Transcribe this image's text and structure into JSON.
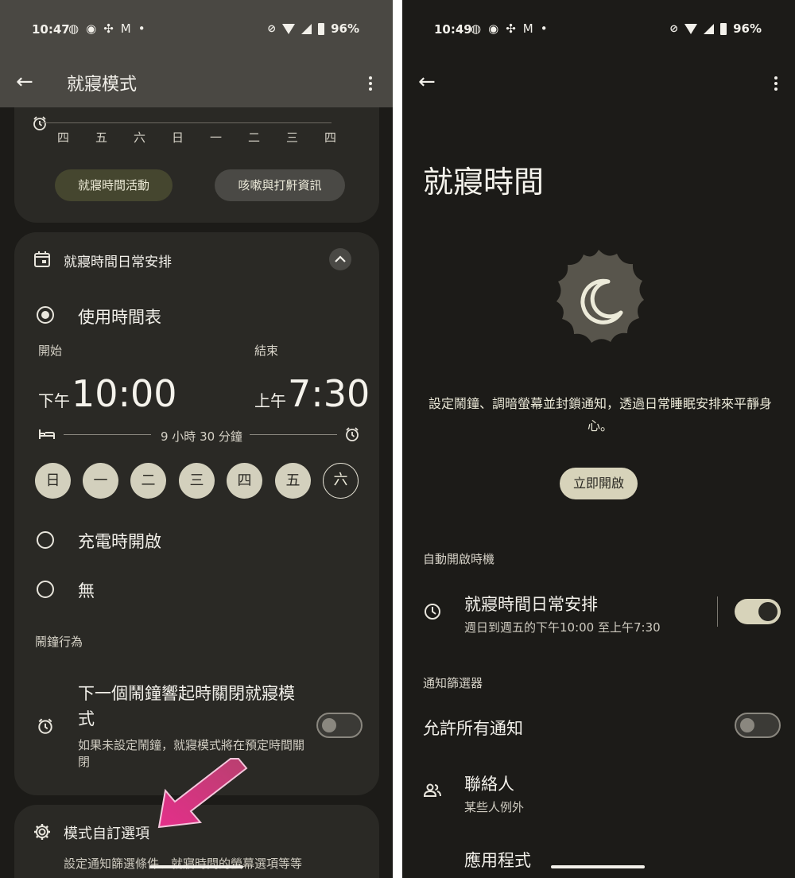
{
  "left": {
    "status": {
      "time": "10:47",
      "notif_icons": [
        "messenger-icon",
        "chat-icon",
        "pinwheel-icon",
        "gmail-icon",
        "dot-icon"
      ],
      "battery": "96%"
    },
    "title": "就寢模式",
    "week_days": [
      "四",
      "五",
      "六",
      "日",
      "一",
      "二",
      "三",
      "四"
    ],
    "buttons": {
      "bedtime_activity": "就寢時間活動",
      "cough_snore": "咳嗽與打鼾資訊"
    },
    "schedule_card": {
      "title": "就寢時間日常安排",
      "option_schedule": "使用時間表",
      "start_label": "開始",
      "end_label": "結束",
      "start_ampm": "下午",
      "start_time": "10:00",
      "end_ampm": "上午",
      "end_time": "7:30",
      "duration": "9 小時 30 分鐘",
      "days": [
        {
          "label": "日",
          "selected": true
        },
        {
          "label": "一",
          "selected": true
        },
        {
          "label": "二",
          "selected": true
        },
        {
          "label": "三",
          "selected": true
        },
        {
          "label": "四",
          "selected": true
        },
        {
          "label": "五",
          "selected": true
        },
        {
          "label": "六",
          "selected": false
        }
      ],
      "option_charging": "充電時開啟",
      "option_none": "無",
      "alarm_section": "鬧鐘行為",
      "alarm_title": "下一個鬧鐘響起時關閉就寢模式",
      "alarm_desc": "如果未設定鬧鐘，就寢模式將在預定時間關閉",
      "alarm_toggle_on": false
    },
    "custom_card": {
      "title": "模式自訂選項",
      "desc": "設定通知篩選條件、就寢時間的螢幕選項等等"
    },
    "colors": {
      "appbar": "#4a4843",
      "arrow": "#d8307f"
    }
  },
  "right": {
    "status": {
      "time": "10:49",
      "notif_icons": [
        "messenger-icon",
        "chat-icon",
        "pinwheel-icon",
        "gmail-icon",
        "dot-icon"
      ],
      "battery": "96%"
    },
    "title": "就寢時間",
    "description": "設定鬧鐘、調暗螢幕並封鎖通知，透過日常睡眠安排來平靜身心。",
    "start_now": "立即開啟",
    "auto_section": "自動開啟時機",
    "routine_title": "就寢時間日常安排",
    "routine_sub": "週日到週五的下午10:00 至上午7:30",
    "routine_toggle_on": true,
    "filter_section": "通知篩選器",
    "allow_all": "允許所有通知",
    "allow_all_toggle_on": false,
    "contacts_title": "聯絡人",
    "contacts_sub": "某些人例外",
    "apps_title": "應用程式"
  }
}
